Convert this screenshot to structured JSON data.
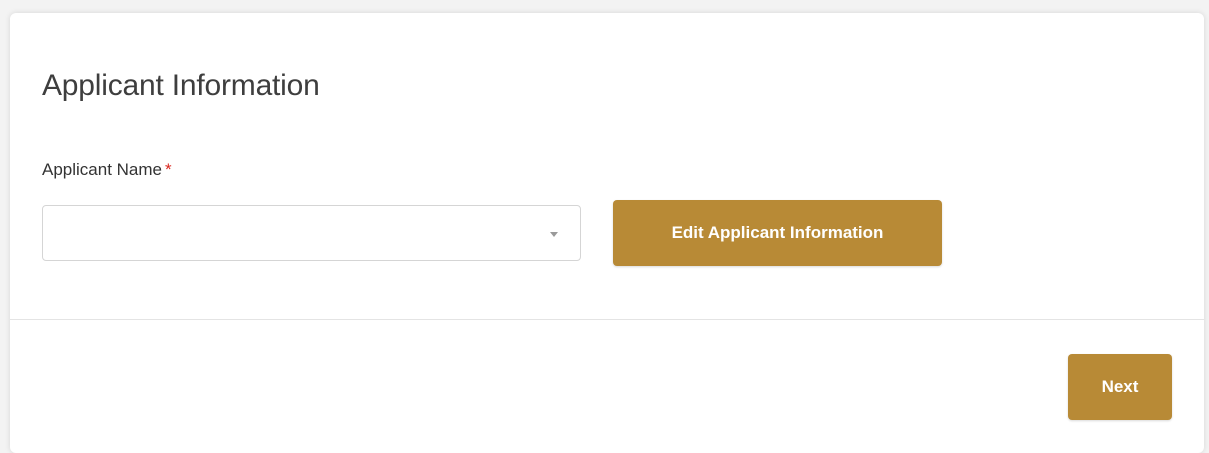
{
  "section": {
    "title": "Applicant Information"
  },
  "form": {
    "applicant_name_label": "Applicant Name",
    "required_marker": "*",
    "applicant_name_value": ""
  },
  "buttons": {
    "edit_label": "Edit Applicant Information",
    "next_label": "Next"
  },
  "icons": {
    "dropdown": "chevron-down-icon"
  },
  "colors": {
    "accent": "#b88a36",
    "required": "#d9251d"
  }
}
